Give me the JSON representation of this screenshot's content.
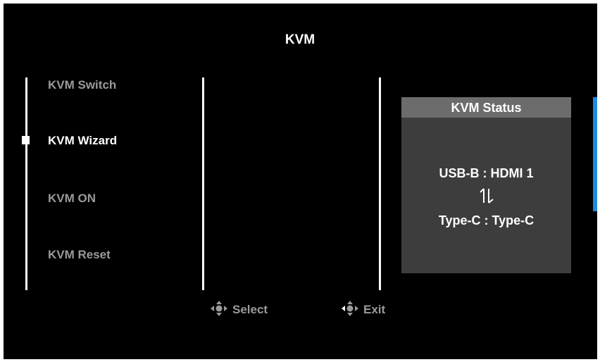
{
  "header": {
    "title": "KVM"
  },
  "menu": {
    "items": [
      {
        "label": "KVM Switch",
        "state": "normal"
      },
      {
        "label": "KVM Wizard",
        "state": "selected"
      },
      {
        "label": "KVM ON",
        "state": "normal"
      },
      {
        "label": "KVM Reset",
        "state": "normal"
      }
    ],
    "selected_index": 1
  },
  "status": {
    "title": "KVM Status",
    "line1": "USB-B : HDMI 1",
    "swap_icon": "swap-arrows-icon",
    "line2": "Type-C : Type-C"
  },
  "footer": {
    "select_label": "Select",
    "select_icon": "joystick-icon",
    "exit_label": "Exit",
    "exit_icon": "joystick-left-icon"
  },
  "colors": {
    "background": "#000000",
    "text_active": "#ffffff",
    "text_inactive": "#9a9a9a",
    "panel": "#3d3d3d",
    "panel_header": "#6c6c6c",
    "accent": "#1e88e5"
  }
}
